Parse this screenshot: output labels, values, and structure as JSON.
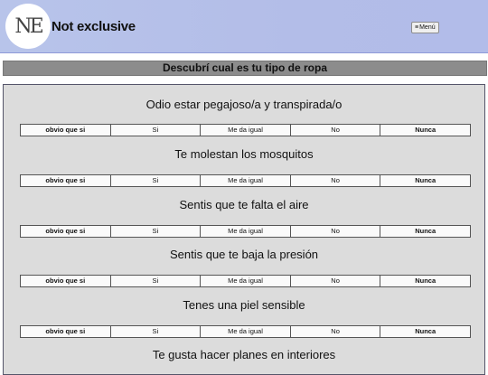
{
  "header": {
    "logo_text": "NE",
    "brand": "Not exclusive",
    "menu_icon": "≡",
    "menu_label": "Menú"
  },
  "banner": "Descubrí cual es tu tipo de ropa",
  "options": [
    "obvio que si",
    "Si",
    "Me da igual",
    "No",
    "Nunca"
  ],
  "questions": [
    "Odio estar pegajoso/a y transpirada/o",
    "Te molestan los mosquitos",
    "Sentis que te falta el aire",
    "Sentis que te baja la presión",
    "Tenes una piel sensible",
    "Te gusta hacer planes en interiores"
  ]
}
